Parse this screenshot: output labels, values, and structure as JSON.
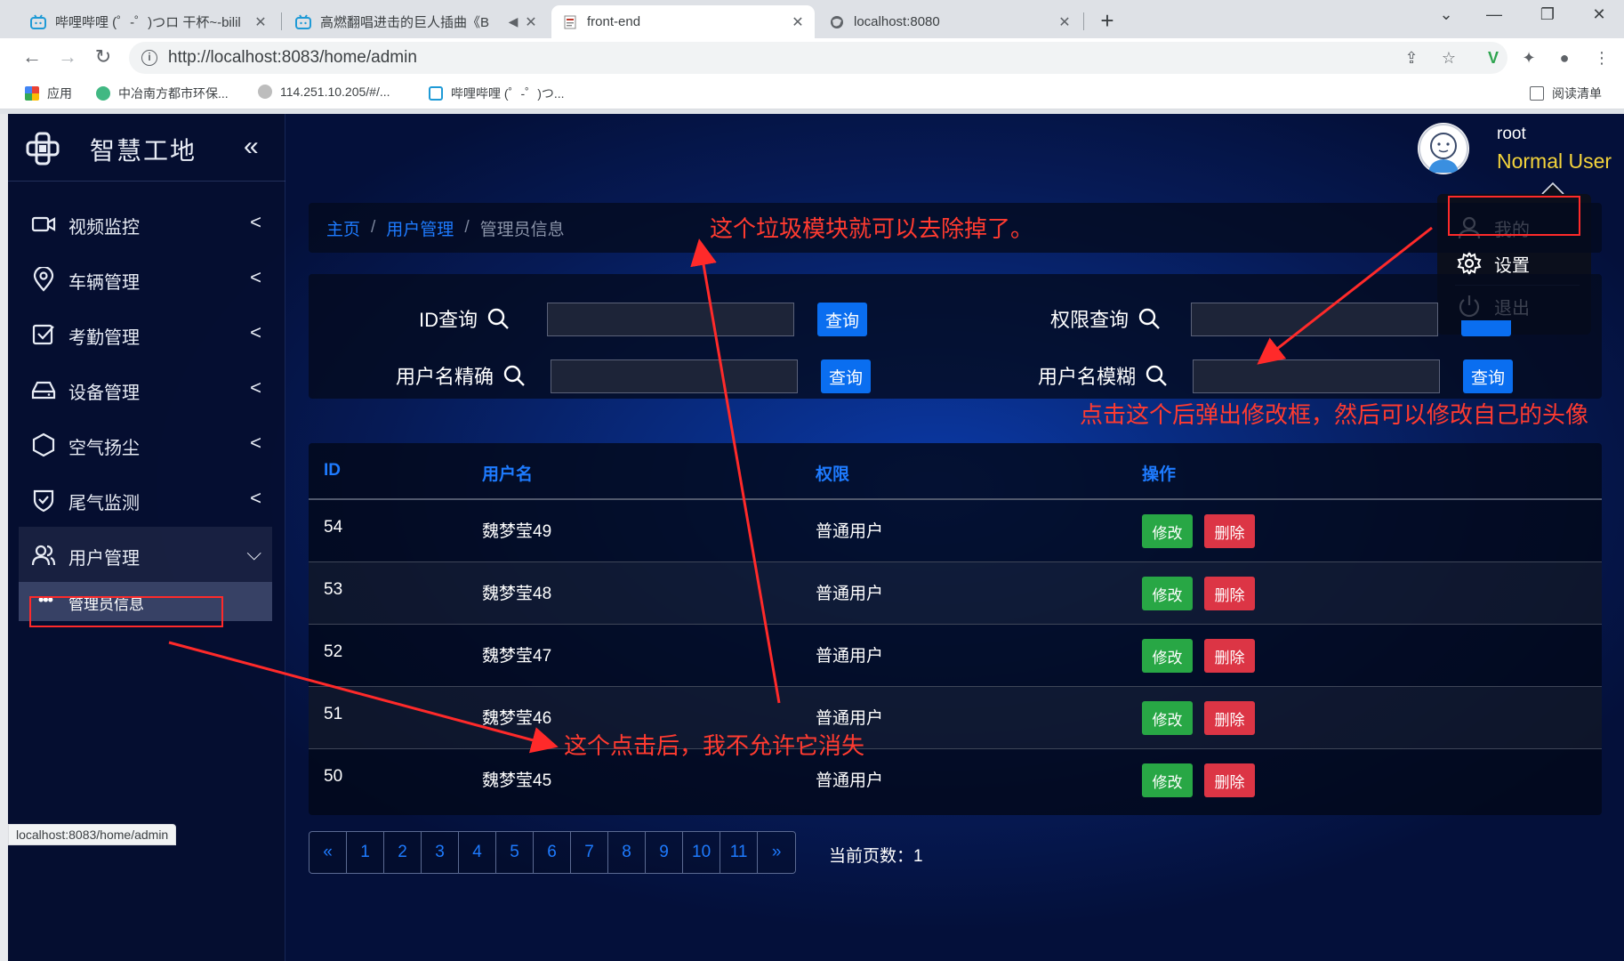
{
  "browser": {
    "tabs": [
      {
        "title": "哔哩哔哩 (゜-゜)つロ 干杯~-bilil",
        "close": "✕"
      },
      {
        "title": "高燃翻唱进击的巨人插曲《B",
        "close": "✕"
      },
      {
        "title": "front-end",
        "close": "✕"
      },
      {
        "title": "localhost:8080",
        "close": "✕"
      }
    ],
    "new_tab": "+",
    "url": "http://localhost:8083/home/admin",
    "bookmarks": [
      {
        "label": "应用"
      },
      {
        "label": "中冶南方都市环保..."
      },
      {
        "label": "114.251.10.205/#/..."
      },
      {
        "label": "哔哩哔哩 (゜-゜)つ..."
      }
    ],
    "reading_list": "阅读清单",
    "status_url": "localhost:8083/home/admin"
  },
  "app": {
    "title": "智慧工地",
    "collapse_icon": "«",
    "menu": [
      {
        "label": "视频监控",
        "icon": "video-icon"
      },
      {
        "label": "车辆管理",
        "icon": "location-icon"
      },
      {
        "label": "考勤管理",
        "icon": "checkbox-icon"
      },
      {
        "label": "设备管理",
        "icon": "drive-icon"
      },
      {
        "label": "空气扬尘",
        "icon": "hexagon-icon"
      },
      {
        "label": "尾气监测",
        "icon": "shield-check-icon"
      },
      {
        "label": "用户管理",
        "icon": "users-icon"
      }
    ],
    "submenu_item": "管理员信息",
    "user": {
      "name": "root",
      "role": "Normal User"
    },
    "dropdown": [
      {
        "label": "我的",
        "icon": "user-icon"
      },
      {
        "label": "设置",
        "icon": "gear-icon"
      },
      {
        "label": "退出",
        "icon": "power-icon"
      }
    ]
  },
  "breadcrumb": {
    "home": "主页",
    "section": "用户管理",
    "current": "管理员信息",
    "sep": "/"
  },
  "search": {
    "id_label": "ID查询",
    "perm_label": "权限查询",
    "exact_label": "用户名精确",
    "fuzzy_label": "用户名模糊",
    "button": "查询"
  },
  "table": {
    "headers": [
      "ID",
      "用户名",
      "权限",
      "操作"
    ],
    "rows": [
      {
        "id": "54",
        "name": "魏梦莹49",
        "perm": "普通用户"
      },
      {
        "id": "53",
        "name": "魏梦莹48",
        "perm": "普通用户"
      },
      {
        "id": "52",
        "name": "魏梦莹47",
        "perm": "普通用户"
      },
      {
        "id": "51",
        "name": "魏梦莹46",
        "perm": "普通用户"
      },
      {
        "id": "50",
        "name": "魏梦莹45",
        "perm": "普通用户"
      }
    ],
    "edit": "修改",
    "delete": "删除"
  },
  "pagination": {
    "prev": "«",
    "pages": [
      "1",
      "2",
      "3",
      "4",
      "5",
      "6",
      "7",
      "8",
      "9",
      "10",
      "11"
    ],
    "next": "»",
    "current_label": "当前页数：1"
  },
  "annotations": {
    "top": "这个垃圾模块就可以去除掉了。",
    "right": "点击这个后弹出修改框，然后可以修改自己的头像",
    "middle": "这个点击后，我不允许它消失"
  },
  "colors": {
    "accent": "#1e7bff",
    "edit": "#28a745",
    "delete": "#dc3545",
    "annotation": "#ff3b30",
    "role": "#f4d43b"
  }
}
